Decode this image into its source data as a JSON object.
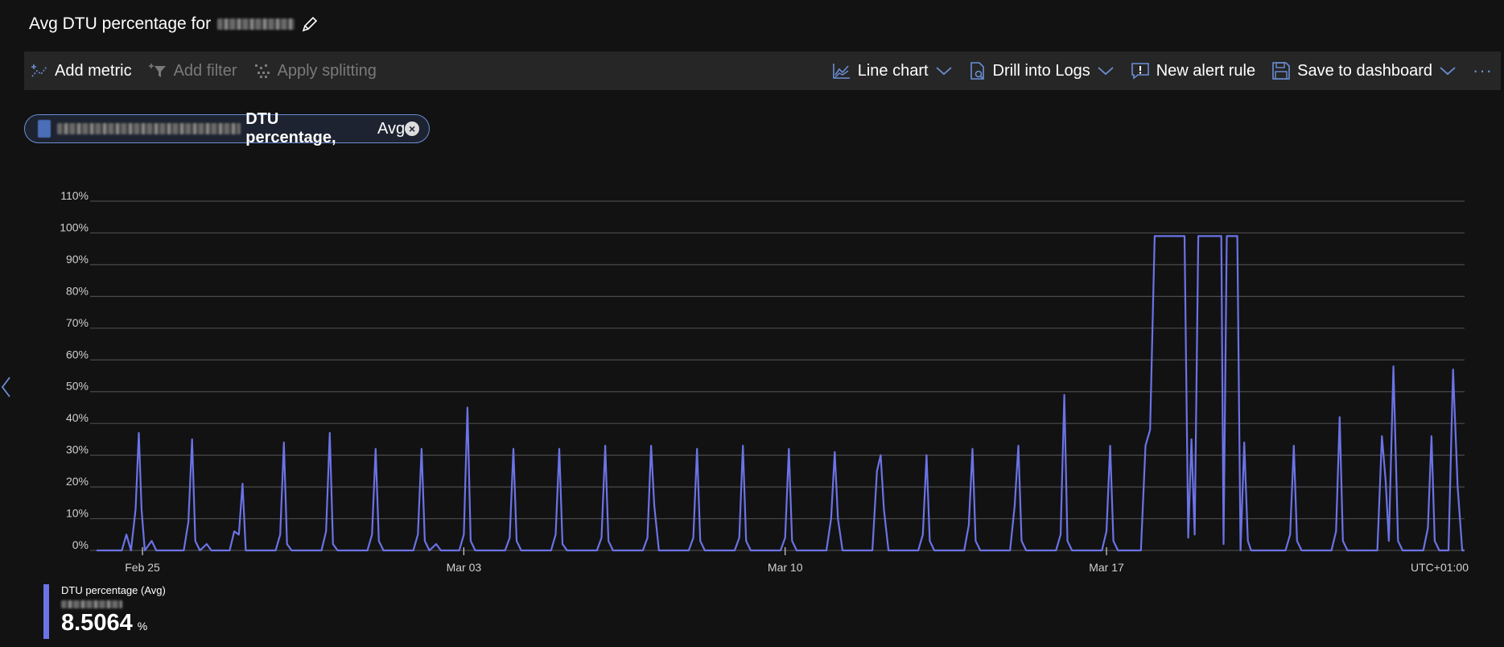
{
  "header": {
    "title_prefix": "Avg DTU percentage for",
    "edit_icon": "pencil-icon"
  },
  "toolbar": {
    "add_metric": "Add metric",
    "add_filter": "Add filter",
    "apply_splitting": "Apply splitting",
    "line_chart": "Line chart",
    "drill_into_logs": "Drill into Logs",
    "new_alert_rule": "New alert rule",
    "save_to_dashboard": "Save to dashboard",
    "more": "···"
  },
  "metric_pill": {
    "metric": "DTU percentage,",
    "aggregation": "Avg"
  },
  "colors": {
    "series": "#6b73e6",
    "accent": "#6b8fd6",
    "grid": "#4a4a4a"
  },
  "chart_data": {
    "type": "line",
    "y_ticks": [
      "0%",
      "10%",
      "20%",
      "30%",
      "40%",
      "50%",
      "60%",
      "70%",
      "80%",
      "90%",
      "100%",
      "110%"
    ],
    "ylim": [
      0,
      110
    ],
    "x_tick_labels": [
      "Feb 25",
      "Mar 03",
      "Mar 10",
      "Mar 17"
    ],
    "timezone_label": "UTC+01:00",
    "x_range_days": [
      0,
      29.8
    ],
    "x_ticks_days": [
      1.0,
      8.0,
      15.0,
      22.0
    ],
    "series": [
      {
        "name": "DTU percentage (Avg)",
        "points": [
          [
            0.0,
            0
          ],
          [
            0.55,
            0
          ],
          [
            0.65,
            5
          ],
          [
            0.75,
            0
          ],
          [
            0.85,
            13
          ],
          [
            0.92,
            37
          ],
          [
            0.98,
            13
          ],
          [
            1.05,
            0
          ],
          [
            1.2,
            3
          ],
          [
            1.3,
            0
          ],
          [
            1.9,
            0
          ],
          [
            2.0,
            9
          ],
          [
            2.08,
            35
          ],
          [
            2.15,
            3
          ],
          [
            2.25,
            0
          ],
          [
            2.4,
            2
          ],
          [
            2.5,
            0
          ],
          [
            2.9,
            0
          ],
          [
            3.0,
            6
          ],
          [
            3.1,
            5
          ],
          [
            3.18,
            21
          ],
          [
            3.25,
            0
          ],
          [
            3.9,
            0
          ],
          [
            4.0,
            5
          ],
          [
            4.08,
            34
          ],
          [
            4.15,
            2
          ],
          [
            4.25,
            0
          ],
          [
            4.9,
            0
          ],
          [
            5.0,
            6
          ],
          [
            5.08,
            37
          ],
          [
            5.15,
            2
          ],
          [
            5.25,
            0
          ],
          [
            5.9,
            0
          ],
          [
            6.0,
            5
          ],
          [
            6.08,
            32
          ],
          [
            6.15,
            3
          ],
          [
            6.25,
            0
          ],
          [
            6.9,
            0
          ],
          [
            7.0,
            5
          ],
          [
            7.08,
            32
          ],
          [
            7.15,
            3
          ],
          [
            7.25,
            0
          ],
          [
            7.4,
            2
          ],
          [
            7.5,
            0
          ],
          [
            7.9,
            0
          ],
          [
            8.0,
            5
          ],
          [
            8.08,
            45
          ],
          [
            8.15,
            3
          ],
          [
            8.25,
            0
          ],
          [
            8.9,
            0
          ],
          [
            9.0,
            4
          ],
          [
            9.08,
            32
          ],
          [
            9.15,
            3
          ],
          [
            9.25,
            0
          ],
          [
            9.9,
            0
          ],
          [
            10.0,
            5
          ],
          [
            10.08,
            32
          ],
          [
            10.15,
            2
          ],
          [
            10.25,
            0
          ],
          [
            10.9,
            0
          ],
          [
            11.0,
            4
          ],
          [
            11.08,
            33
          ],
          [
            11.15,
            3
          ],
          [
            11.25,
            0
          ],
          [
            11.9,
            0
          ],
          [
            12.0,
            4
          ],
          [
            12.08,
            33
          ],
          [
            12.15,
            14
          ],
          [
            12.25,
            0
          ],
          [
            12.9,
            0
          ],
          [
            13.0,
            4
          ],
          [
            13.08,
            32
          ],
          [
            13.15,
            3
          ],
          [
            13.25,
            0
          ],
          [
            13.9,
            0
          ],
          [
            14.0,
            4
          ],
          [
            14.08,
            33
          ],
          [
            14.15,
            3
          ],
          [
            14.25,
            0
          ],
          [
            14.9,
            0
          ],
          [
            15.0,
            4
          ],
          [
            15.08,
            32
          ],
          [
            15.15,
            3
          ],
          [
            15.25,
            0
          ],
          [
            15.9,
            0
          ],
          [
            16.0,
            10
          ],
          [
            16.08,
            31
          ],
          [
            16.15,
            10
          ],
          [
            16.25,
            0
          ],
          [
            16.9,
            0
          ],
          [
            17.0,
            25
          ],
          [
            17.08,
            30
          ],
          [
            17.15,
            13
          ],
          [
            17.25,
            0
          ],
          [
            17.9,
            0
          ],
          [
            18.0,
            5
          ],
          [
            18.08,
            30
          ],
          [
            18.15,
            3
          ],
          [
            18.25,
            0
          ],
          [
            18.9,
            0
          ],
          [
            19.0,
            8
          ],
          [
            19.08,
            32
          ],
          [
            19.15,
            3
          ],
          [
            19.25,
            0
          ],
          [
            19.9,
            0
          ],
          [
            20.0,
            14
          ],
          [
            20.08,
            33
          ],
          [
            20.15,
            3
          ],
          [
            20.25,
            0
          ],
          [
            20.9,
            0
          ],
          [
            21.0,
            5
          ],
          [
            21.08,
            49
          ],
          [
            21.15,
            3
          ],
          [
            21.25,
            0
          ],
          [
            21.9,
            0
          ],
          [
            22.0,
            6
          ],
          [
            22.08,
            33
          ],
          [
            22.15,
            3
          ],
          [
            22.25,
            0
          ],
          [
            22.75,
            0
          ],
          [
            22.85,
            33
          ],
          [
            22.95,
            38
          ],
          [
            23.05,
            99
          ],
          [
            23.7,
            99
          ],
          [
            23.78,
            4
          ],
          [
            23.85,
            35
          ],
          [
            23.92,
            5
          ],
          [
            24.0,
            99
          ],
          [
            24.5,
            99
          ],
          [
            24.55,
            2
          ],
          [
            24.62,
            99
          ],
          [
            24.85,
            99
          ],
          [
            24.92,
            0
          ],
          [
            25.0,
            34
          ],
          [
            25.08,
            3
          ],
          [
            25.15,
            0
          ],
          [
            25.9,
            0
          ],
          [
            26.0,
            5
          ],
          [
            26.08,
            33
          ],
          [
            26.15,
            3
          ],
          [
            26.25,
            0
          ],
          [
            26.9,
            0
          ],
          [
            27.0,
            6
          ],
          [
            27.08,
            42
          ],
          [
            27.15,
            3
          ],
          [
            27.25,
            0
          ],
          [
            27.9,
            0
          ],
          [
            28.0,
            36
          ],
          [
            28.08,
            22
          ],
          [
            28.15,
            3
          ],
          [
            28.25,
            58
          ],
          [
            28.35,
            3
          ],
          [
            28.45,
            0
          ],
          [
            28.9,
            0
          ],
          [
            29.0,
            7
          ],
          [
            29.08,
            36
          ],
          [
            29.15,
            3
          ],
          [
            29.25,
            0
          ],
          [
            29.45,
            0
          ],
          [
            29.55,
            57
          ],
          [
            29.65,
            20
          ],
          [
            29.75,
            0
          ],
          [
            29.8,
            0
          ]
        ]
      }
    ]
  },
  "legend": {
    "label": "DTU percentage (Avg)",
    "value": "8.5064",
    "unit": "%"
  }
}
